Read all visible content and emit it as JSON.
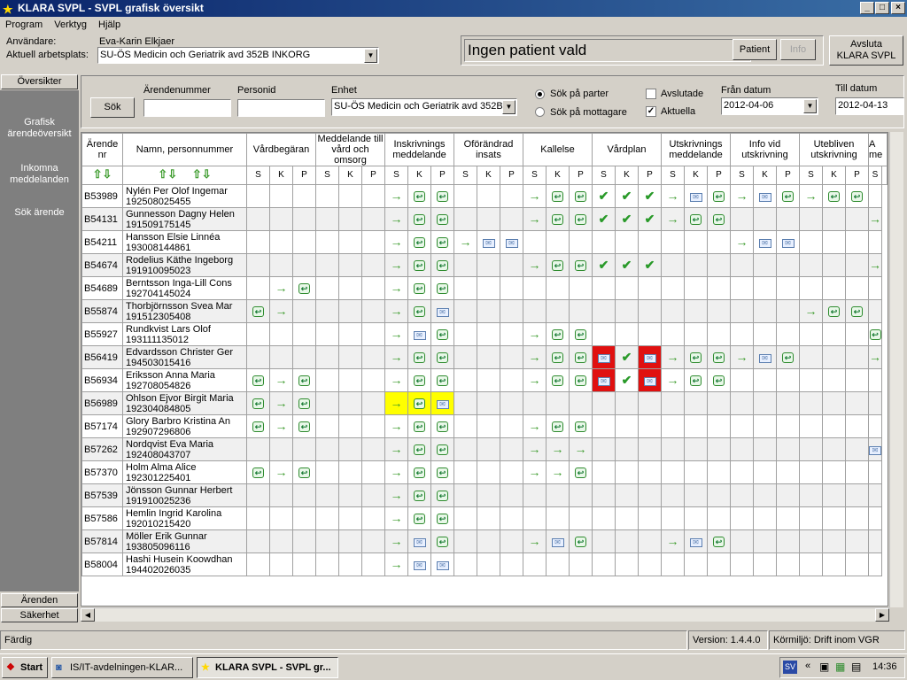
{
  "window": {
    "title": "KLARA SVPL - SVPL grafisk översikt"
  },
  "menu": [
    "Program",
    "Verktyg",
    "Hjälp"
  ],
  "header": {
    "user_label": "Användare:",
    "user_value": "Eva-Karin Elkjaer",
    "workplace_label": "Aktuell arbetsplats:",
    "workplace_value": "SU-ÖS Medicin och Geriatrik avd 352B INKORG",
    "patient_display": "Ingen patient vald",
    "patient_button": "Patient",
    "info_button": "Info",
    "exit_button_line1": "Avsluta",
    "exit_button_line2": "KLARA SVPL"
  },
  "sidebar": {
    "top_tab": "Översikter",
    "links": [
      "Grafisk ärendeöversikt",
      "Inkomna meddelanden",
      "Sök ärende"
    ],
    "bottom_tabs": [
      "Ärenden",
      "Säkerhet"
    ]
  },
  "search": {
    "button": "Sök",
    "arende_label": "Ärendenummer",
    "arende_value": "",
    "personid_label": "Personid",
    "personid_value": "",
    "enhet_label": "Enhet",
    "enhet_value": "SU-ÖS Medicin och Geriatrik avd 352B",
    "radio1": "Sök på parter",
    "radio2": "Sök på mottagare",
    "check1": "Avslutade",
    "check2": "Aktuella",
    "from_label": "Från datum",
    "from_value": "2012-04-06",
    "to_label": "Till datum",
    "to_value": "2012-04-13"
  },
  "grid": {
    "col_arende": "Ärende nr",
    "col_namn": "Namn, personnummer",
    "groups": [
      "Vårdbegäran",
      "Meddelande till vård och omsorg",
      "Inskrivnings meddelande",
      "Oförändrad insats",
      "Kallelse",
      "Vårdplan",
      "Utskrivnings meddelande",
      "Info vid utskrivning",
      "Utebliven utskrivning",
      "A me"
    ],
    "sub_labels": [
      "S",
      "K",
      "P"
    ],
    "rows": [
      {
        "id": "B53989",
        "name": "Nylén Per Olof Ingemar",
        "pnr": "192508025455",
        "cells": [
          "",
          "",
          "",
          "",
          "",
          "",
          "a",
          "r",
          "r",
          "",
          "",
          "",
          "a",
          "r",
          "r",
          "c",
          "c",
          "c",
          "a",
          "m",
          "r",
          "a",
          "m",
          "r",
          "a",
          "r",
          "r",
          ""
        ]
      },
      {
        "id": "B54131",
        "name": "Gunnesson Dagny Helen",
        "pnr": "191509175145",
        "cells": [
          "",
          "",
          "",
          "",
          "",
          "",
          "a",
          "r",
          "r",
          "",
          "",
          "",
          "a",
          "r",
          "r",
          "c",
          "c",
          "c",
          "a",
          "r",
          "r",
          "",
          "",
          "",
          "",
          "",
          "",
          "a"
        ]
      },
      {
        "id": "B54211",
        "name": "Hansson Elsie Linnéa",
        "pnr": "193008144861",
        "cells": [
          "",
          "",
          "",
          "",
          "",
          "",
          "a",
          "r",
          "r",
          "a",
          "m",
          "m",
          "",
          "",
          "",
          "",
          "",
          "",
          "",
          "",
          "",
          "a",
          "m",
          "m",
          "",
          "",
          "",
          ""
        ]
      },
      {
        "id": "B54674",
        "name": "Rodelius Käthe Ingeborg",
        "pnr": "191910095023",
        "cells": [
          "",
          "",
          "",
          "",
          "",
          "",
          "a",
          "r",
          "r",
          "",
          "",
          "",
          "a",
          "r",
          "r",
          "c",
          "c",
          "c",
          "",
          "",
          "",
          "",
          "",
          "",
          "",
          "",
          "",
          "a"
        ]
      },
      {
        "id": "B54689",
        "name": "Berntsson Inga-Lill Cons",
        "pnr": "192704145024",
        "cells": [
          "",
          "a",
          "r",
          "",
          "",
          "",
          "a",
          "r",
          "r",
          "",
          "",
          "",
          "",
          "",
          "",
          "",
          "",
          "",
          "",
          "",
          "",
          "",
          "",
          "",
          "",
          "",
          "",
          ""
        ]
      },
      {
        "id": "B55874",
        "name": "Thorbjörnsson Svea Mar",
        "pnr": "191512305408",
        "cells": [
          "r",
          "a",
          "",
          "",
          "",
          "",
          "a",
          "r",
          "m",
          "",
          "",
          "",
          "",
          "",
          "",
          "",
          "",
          "",
          "",
          "",
          "",
          "",
          "",
          "",
          "a",
          "r",
          "r",
          ""
        ]
      },
      {
        "id": "B55927",
        "name": "Rundkvist Lars Olof",
        "pnr": "193111135012",
        "cells": [
          "",
          "",
          "",
          "",
          "",
          "",
          "a",
          "m",
          "r",
          "",
          "",
          "",
          "a",
          "r",
          "r",
          "",
          "",
          "",
          "",
          "",
          "",
          "",
          "",
          "",
          "",
          "",
          "",
          "r"
        ]
      },
      {
        "id": "B56419",
        "name": "Edvardsson Christer Ger",
        "pnr": "194503015416",
        "cells": [
          "",
          "",
          "",
          "",
          "",
          "",
          "a",
          "r",
          "r",
          "",
          "",
          "",
          "a",
          "r",
          "r",
          "R",
          "c",
          "R",
          "a",
          "r",
          "r",
          "a",
          "m",
          "r",
          "",
          "",
          "",
          "a"
        ]
      },
      {
        "id": "B56934",
        "name": "Eriksson Anna Maria",
        "pnr": "192708054826",
        "cells": [
          "r",
          "a",
          "r",
          "",
          "",
          "",
          "a",
          "r",
          "r",
          "",
          "",
          "",
          "a",
          "r",
          "r",
          "R",
          "c",
          "R",
          "a",
          "r",
          "r",
          "",
          "",
          "",
          "",
          "",
          "",
          ""
        ]
      },
      {
        "id": "B56989",
        "name": "Ohlson Ejvor Birgit Maria",
        "pnr": "192304084805",
        "cells": [
          "r",
          "a",
          "r",
          "",
          "",
          "",
          "Ya",
          "Yr",
          "Ym",
          "",
          "",
          "",
          "",
          "",
          "",
          "",
          "",
          "",
          "",
          "",
          "",
          "",
          "",
          "",
          "",
          "",
          "",
          ""
        ]
      },
      {
        "id": "B57174",
        "name": "Glory Barbro Kristina An",
        "pnr": "192907296806",
        "cells": [
          "r",
          "a",
          "r",
          "",
          "",
          "",
          "a",
          "r",
          "r",
          "",
          "",
          "",
          "a",
          "r",
          "r",
          "",
          "",
          "",
          "",
          "",
          "",
          "",
          "",
          "",
          "",
          "",
          "",
          ""
        ]
      },
      {
        "id": "B57262",
        "name": "Nordqvist Eva Maria",
        "pnr": "192408043707",
        "cells": [
          "",
          "",
          "",
          "",
          "",
          "",
          "a",
          "r",
          "r",
          "",
          "",
          "",
          "a",
          "a",
          "a",
          "",
          "",
          "",
          "",
          "",
          "",
          "",
          "",
          "",
          "",
          "",
          "",
          "m"
        ]
      },
      {
        "id": "B57370",
        "name": "Holm Alma Alice",
        "pnr": "192301225401",
        "cells": [
          "r",
          "a",
          "r",
          "",
          "",
          "",
          "a",
          "r",
          "r",
          "",
          "",
          "",
          "a",
          "a",
          "r",
          "",
          "",
          "",
          "",
          "",
          "",
          "",
          "",
          "",
          "",
          "",
          "",
          ""
        ]
      },
      {
        "id": "B57539",
        "name": "Jönsson Gunnar Herbert",
        "pnr": "191910025236",
        "cells": [
          "",
          "",
          "",
          "",
          "",
          "",
          "a",
          "r",
          "r",
          "",
          "",
          "",
          "",
          "",
          "",
          "",
          "",
          "",
          "",
          "",
          "",
          "",
          "",
          "",
          "",
          "",
          "",
          ""
        ]
      },
      {
        "id": "B57586",
        "name": "Hemlin Ingrid Karolina",
        "pnr": "192010215420",
        "cells": [
          "",
          "",
          "",
          "",
          "",
          "",
          "a",
          "r",
          "r",
          "",
          "",
          "",
          "",
          "",
          "",
          "",
          "",
          "",
          "",
          "",
          "",
          "",
          "",
          "",
          "",
          "",
          "",
          ""
        ]
      },
      {
        "id": "B57814",
        "name": "Möller Erik Gunnar",
        "pnr": "193805096116",
        "cells": [
          "",
          "",
          "",
          "",
          "",
          "",
          "a",
          "m",
          "r",
          "",
          "",
          "",
          "a",
          "m",
          "r",
          "",
          "",
          "",
          "a",
          "m",
          "r",
          "",
          "",
          "",
          "",
          "",
          "",
          ""
        ]
      },
      {
        "id": "B58004",
        "name": "Hashi Husein Koowdhan",
        "pnr": "194402026035",
        "cells": [
          "",
          "",
          "",
          "",
          "",
          "",
          "a",
          "m",
          "m",
          "",
          "",
          "",
          "",
          "",
          "",
          "",
          "",
          "",
          "",
          "",
          "",
          "",
          "",
          "",
          "",
          "",
          "",
          ""
        ]
      }
    ]
  },
  "status": {
    "left": "Färdig",
    "version": "Version: 1.4.4.0",
    "env": "Körmiljö: Drift  inom VGR"
  },
  "taskbar": {
    "start": "Start",
    "tasks": [
      "IS/IT-avdelningen-KLAR...",
      "KLARA SVPL - SVPL gr..."
    ],
    "lang": "SV",
    "time": "14:36"
  }
}
